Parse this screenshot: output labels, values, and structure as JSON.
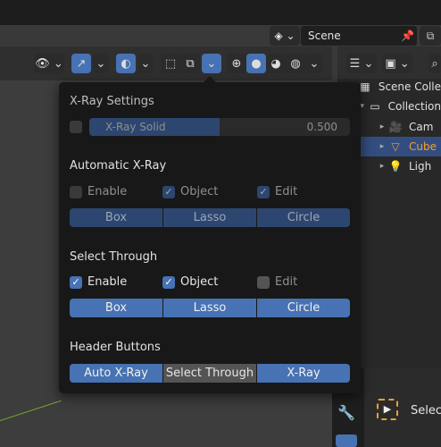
{
  "scene": {
    "name": "Scene"
  },
  "outliner": {
    "rows": [
      {
        "label": "Scene Colle"
      },
      {
        "label": "Collection"
      },
      {
        "label": "Cam"
      },
      {
        "label": "Cube"
      },
      {
        "label": "Ligh"
      }
    ]
  },
  "properties": {
    "tool_label": "Select"
  },
  "popup": {
    "xray": {
      "title": "X-Ray Settings",
      "slider_name": "X-Ray Solid",
      "slider_value": "0.500",
      "slider_fraction": 0.5
    },
    "auto_xray": {
      "title": "Automatic X-Ray",
      "enable": "Enable",
      "object": "Object",
      "edit": "Edit",
      "modes": [
        "Box",
        "Lasso",
        "Circle"
      ]
    },
    "select_through": {
      "title": "Select Through",
      "enable": "Enable",
      "object": "Object",
      "edit": "Edit",
      "modes": [
        "Box",
        "Lasso",
        "Circle"
      ]
    },
    "header_buttons": {
      "title": "Header Buttons",
      "buttons": [
        "Auto X-Ray",
        "Select Through",
        "X-Ray"
      ]
    }
  },
  "colors": {
    "accent": "#4772b3",
    "accent_dim": "#2c4670",
    "popup_bg": "#181818"
  }
}
